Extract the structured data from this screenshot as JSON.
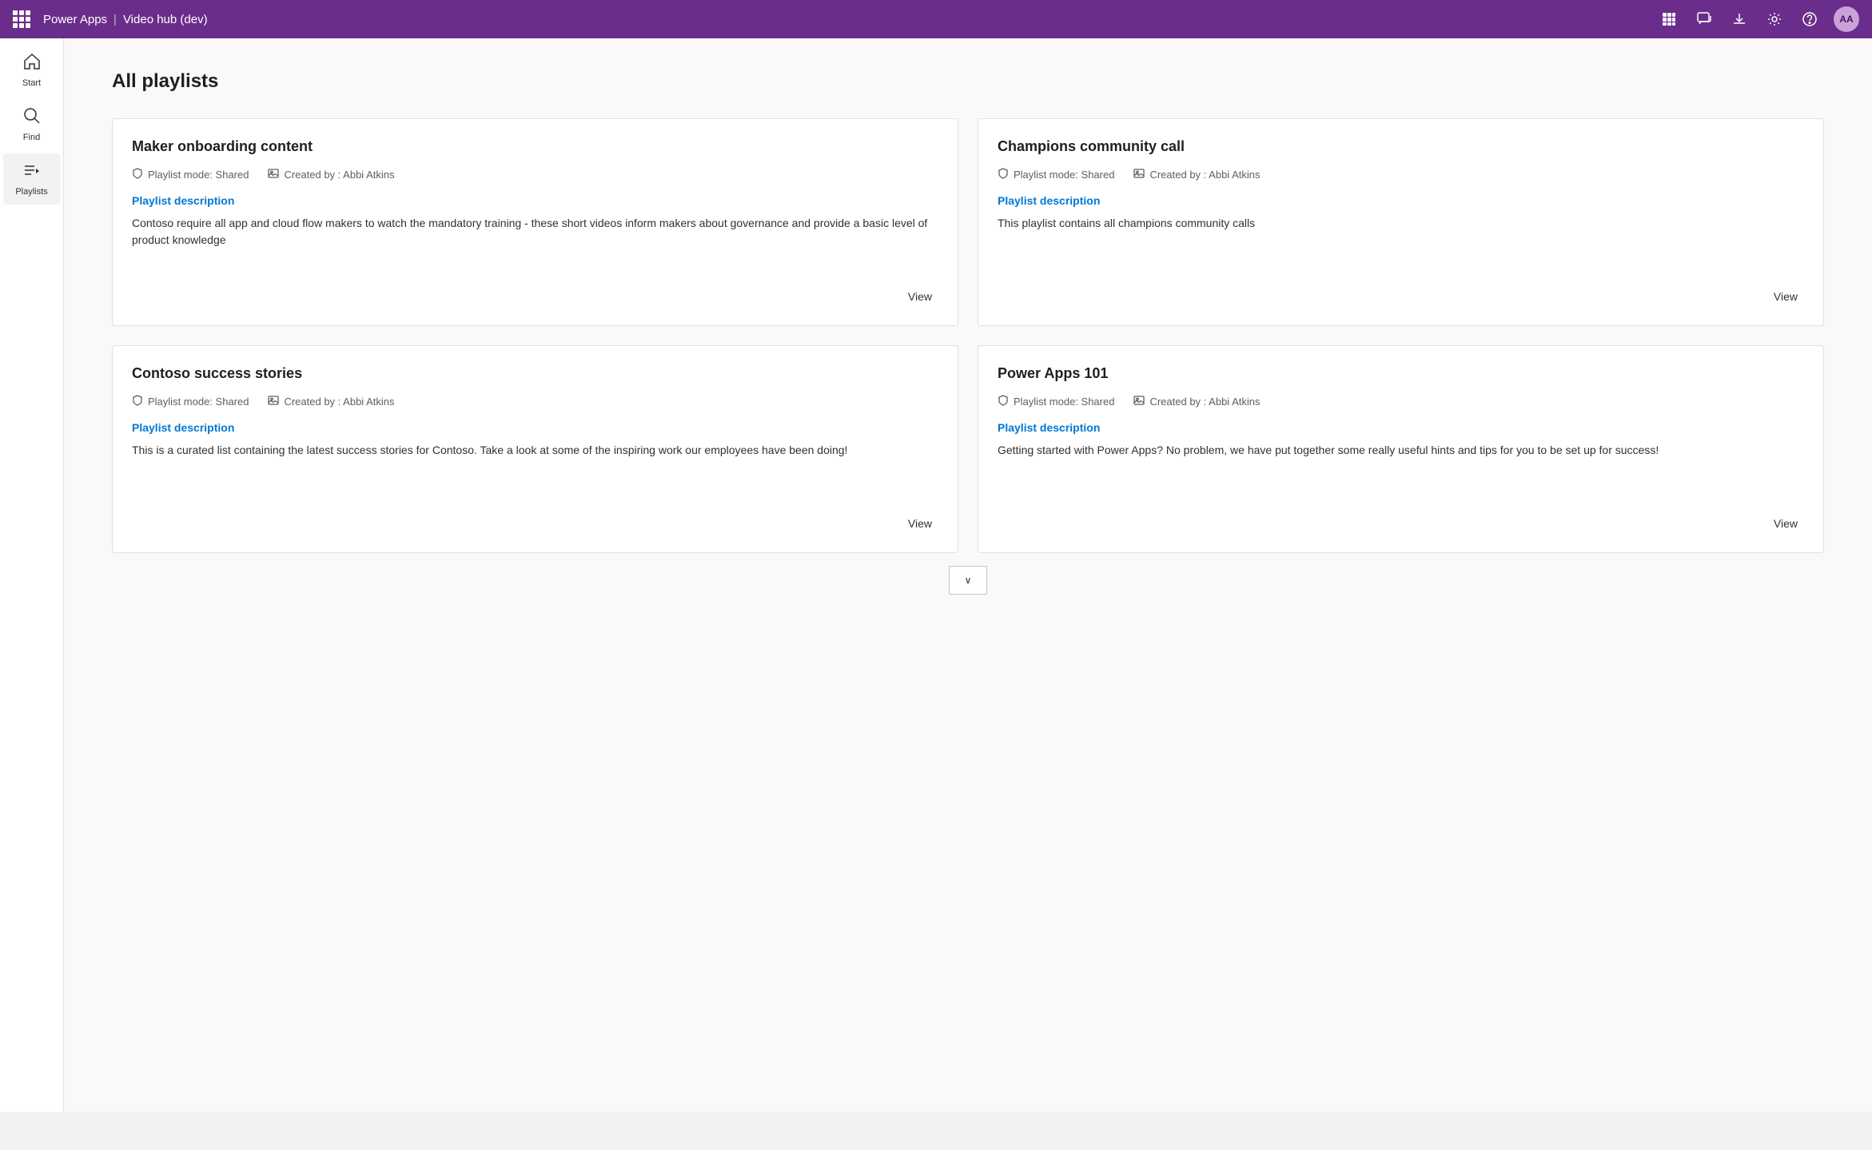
{
  "app": {
    "title": "Power Apps",
    "separator": "|",
    "subtitle": "Video hub (dev)"
  },
  "topnav": {
    "icons": {
      "apps": "⊞",
      "chat": "💬",
      "download": "⬇",
      "settings": "⚙",
      "help": "?",
      "avatar_initials": "AA"
    }
  },
  "sidebar": {
    "items": [
      {
        "id": "start",
        "label": "Start",
        "icon": "🏠"
      },
      {
        "id": "find",
        "label": "Find",
        "icon": "🔍"
      },
      {
        "id": "playlists",
        "label": "Playlists",
        "icon": "☰"
      }
    ]
  },
  "main": {
    "page_title": "All playlists",
    "playlists": [
      {
        "id": "maker-onboarding",
        "title": "Maker onboarding content",
        "meta_mode": "Playlist mode: Shared",
        "meta_created": "Created by : Abbi Atkins",
        "description_label": "Playlist description",
        "description": "Contoso require all app and cloud flow makers to watch the mandatory training - these short videos inform makers about governance and provide a basic level of product knowledge",
        "view_label": "View"
      },
      {
        "id": "champions-community",
        "title": "Champions community call",
        "meta_mode": "Playlist mode: Shared",
        "meta_created": "Created by : Abbi Atkins",
        "description_label": "Playlist description",
        "description": "This playlist contains all champions community calls",
        "view_label": "View"
      },
      {
        "id": "contoso-success",
        "title": "Contoso success stories",
        "meta_mode": "Playlist mode: Shared",
        "meta_created": "Created by : Abbi Atkins",
        "description_label": "Playlist description",
        "description": "This is a curated list containing the latest success stories for Contoso.  Take a look at some of the inspiring work our employees have been doing!",
        "view_label": "View"
      },
      {
        "id": "power-apps-101",
        "title": "Power Apps 101",
        "meta_mode": "Playlist mode: Shared",
        "meta_created": "Created by : Abbi Atkins",
        "description_label": "Playlist description",
        "description": "Getting started with Power Apps?  No problem, we have put together some really useful hints and tips for you to be set up for success!",
        "view_label": "View"
      }
    ],
    "scroll_down_label": "∨"
  }
}
